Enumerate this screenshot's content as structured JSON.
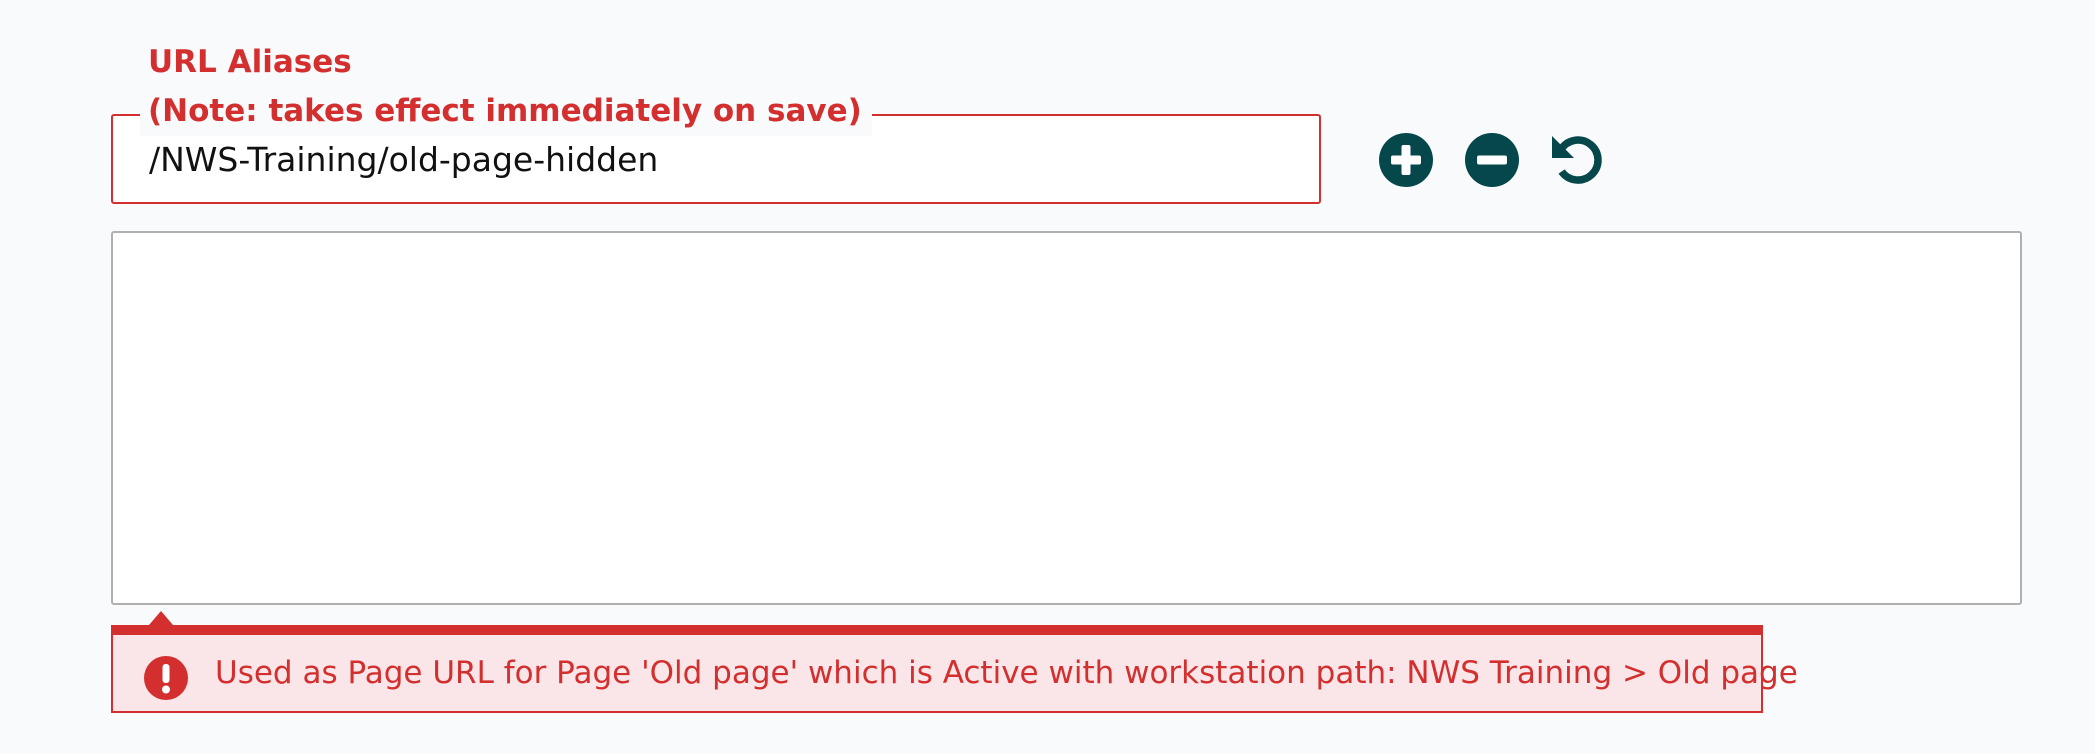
{
  "alias_field": {
    "label_line1": "URL Aliases",
    "label_line2": "(Note: takes effect immediately on save)",
    "value": "/NWS-Training/old-page-hidden"
  },
  "actions": {
    "add_icon": "plus-circle-icon",
    "remove_icon": "minus-circle-icon",
    "reset_icon": "undo-icon",
    "icon_color": "#06474b"
  },
  "aliases_list": {
    "value": ""
  },
  "error": {
    "icon": "exclamation-circle-icon",
    "message": "Used as Page URL for Page 'Old page' which is Active with workstation path: NWS Training > Old page",
    "color": "#d32f2f",
    "background": "#fae6e8"
  }
}
